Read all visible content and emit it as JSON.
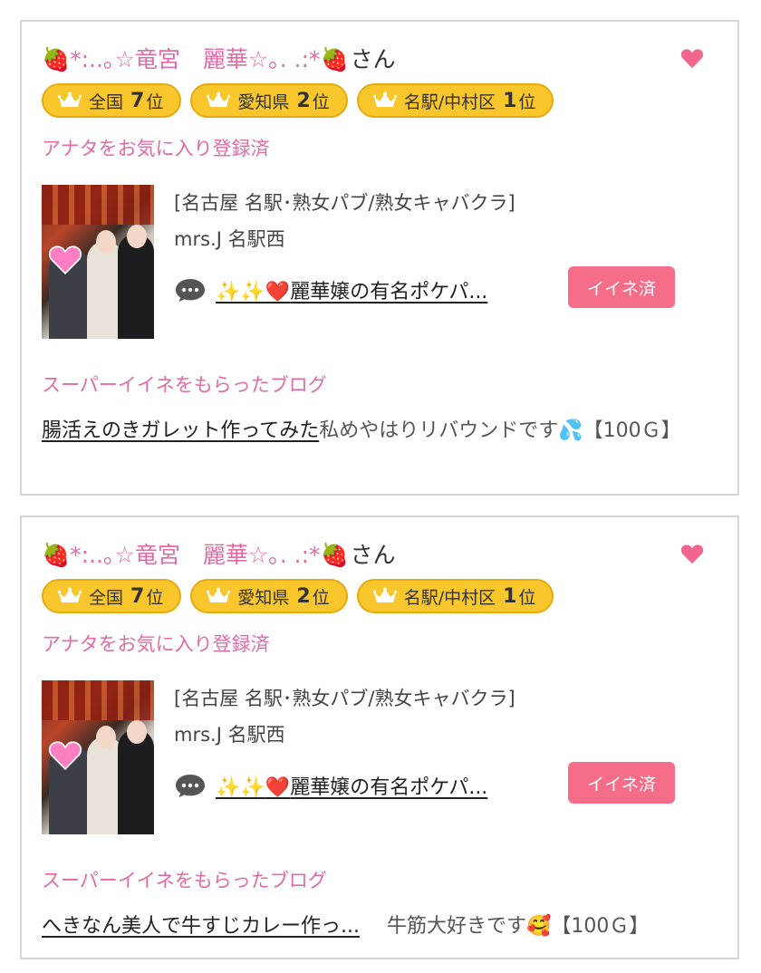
{
  "cards": [
    {
      "cast_name": "🍓*:..｡☆竜宮　麗華☆｡. .:*🍓",
      "honorific": "さん",
      "rankings": [
        {
          "area": "全国",
          "rank": "7",
          "suffix": "位"
        },
        {
          "area": "愛知県",
          "rank": "2",
          "suffix": "位"
        },
        {
          "area": "名駅/中村区",
          "rank": "1",
          "suffix": "位"
        }
      ],
      "favorite_status": "アナタをお気に入り登録済",
      "shop_category": "[名古屋 名駅･熟女パブ/熟女キャバクラ]",
      "store_name": "mrs.J 名駅西",
      "blog_title_sparkle": "✨✨",
      "blog_title_heart": "❤️",
      "blog_title_text": "麗華嬢の有名ポケパ...",
      "iine_button": "イイネ済",
      "super_label": "スーパーイイネをもらったブログ",
      "super_blog_link": "腸活えのきガレット作ってみた",
      "super_blog_comment": "私めやはりリバウンドです💦【100Ｇ】"
    },
    {
      "cast_name": "🍓*:..｡☆竜宮　麗華☆｡. .:*🍓",
      "honorific": "さん",
      "rankings": [
        {
          "area": "全国",
          "rank": "7",
          "suffix": "位"
        },
        {
          "area": "愛知県",
          "rank": "2",
          "suffix": "位"
        },
        {
          "area": "名駅/中村区",
          "rank": "1",
          "suffix": "位"
        }
      ],
      "favorite_status": "アナタをお気に入り登録済",
      "shop_category": "[名古屋 名駅･熟女パブ/熟女キャバクラ]",
      "store_name": "mrs.J 名駅西",
      "blog_title_sparkle": "✨✨",
      "blog_title_heart": "❤️",
      "blog_title_text": "麗華嬢の有名ポケパ...",
      "iine_button": "イイネ済",
      "super_label": "スーパーイイネをもらったブログ",
      "super_blog_link": "へきなん美人で牛すじカレー作っ...",
      "super_blog_comment": "牛筋大好きです🥰【100Ｇ】"
    }
  ],
  "colors": {
    "pink_text": "#e36aa5",
    "badge_gold": "#f9c62c",
    "iine_button": "#f56d88",
    "heart": "#f0668f"
  },
  "icons": [
    "heart-icon",
    "crown-icon",
    "speech-bubble-icon",
    "heart-sticker"
  ]
}
